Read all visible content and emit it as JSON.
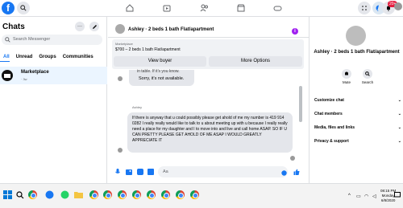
{
  "topbar": {
    "logo": "f",
    "notification_count": "20+"
  },
  "sidebar": {
    "title": "Chats",
    "search_placeholder": "Search Messenger",
    "filters": [
      "All",
      "Unread",
      "Groups",
      "Communities"
    ],
    "active_filter": "All",
    "conversation": {
      "name": "Marketplace",
      "time": "· 3w"
    }
  },
  "chat": {
    "header_title": "Ashley · 2 beds 1 bath Flat/apartment",
    "listing": {
      "label": "Marketplace",
      "item": "$700 – 2 beds 1 bath Flat/apartment",
      "view_buyer": "View buyer",
      "more_options": "More Options"
    },
    "cut_text": "in table. If it's you know.",
    "unavailable": "Sorry, it's not available.",
    "sender": "Ashley",
    "long_message": "If there is anyway that u could possibly please get ahold of me my number is 419 914 0282 I really really would like to talk to u about meeting up with u because I really really need a place for my daughter and I to move into and live and call home ASAP. SO IF U CAN PRETTY PLEASE GET AHOLD OF ME ASAP I WOULD GREATLY APPRECIATE IT",
    "composer_placeholder": "Aa"
  },
  "info_panel": {
    "name": "Ashley · 2 beds 1 bath Flat/apartment",
    "mute_label": "Mute",
    "search_label": "Search",
    "sections": [
      "Customize chat",
      "Chat members",
      "Media, files and links",
      "Privacy & support"
    ]
  },
  "taskbar": {
    "time": "08:15 PM",
    "day": "Monday",
    "date": "6/8/2020"
  },
  "colors": {
    "accent": "#1877f2",
    "purple": "#a020f0"
  }
}
